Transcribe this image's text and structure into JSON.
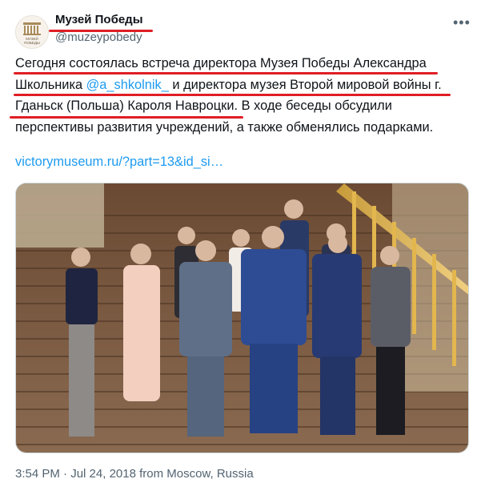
{
  "account": {
    "name": "Музей Победы",
    "handle": "@muzeypobedy",
    "avatar_caption_1": "МУЗЕЙ",
    "avatar_caption_2": "ПОБЕДЫ"
  },
  "tweet": {
    "line1": "Сегодня состоялась встреча директора Музея Победы Александра",
    "line2_pre": "Школьника ",
    "mention": "@a_shkolnik_",
    "line2_post": " и директора музея Второй мировой войны г.",
    "line3": "Гданьск (Польша) Кароля Навроцки. В ходе беседы обсудили",
    "line4": "перспективы развития учреждений, а также обменялись подарками.",
    "link_text": "victorymuseum.ru/?part=13&id_si…",
    "photo_alt": "Group photo of museum directors on a staircase"
  },
  "meta": {
    "time": "3:54 PM",
    "sep1": " · ",
    "date": "Jul 24, 2018",
    "from": " from ",
    "location": "Moscow, Russia"
  },
  "icons": {
    "more": "more-horizontal-icon",
    "avatar": "museum-building-logo"
  },
  "colors": {
    "accent": "#1d9bf0",
    "annotation": "#e01e25",
    "secondary_text": "#536471"
  }
}
